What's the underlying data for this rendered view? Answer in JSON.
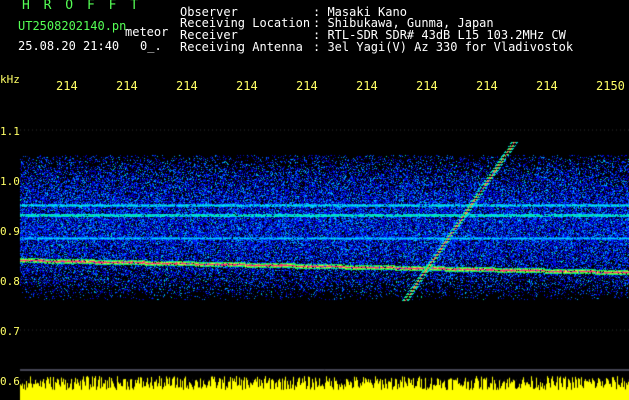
{
  "header": {
    "app_title": "H R O F F T",
    "file_name": "UT2508202140.pn",
    "meteor_label": "meteor",
    "timestamp": "25.08.20 21:40",
    "marker": "0_.",
    "fields": [
      {
        "label": "Observer",
        "value": ": Masaki Kano"
      },
      {
        "label": "Receiving Location",
        "value": ": Shibukawa, Gunma, Japan"
      },
      {
        "label": "Receiver",
        "value": ": RTL-SDR SDR# 43dB L15 103.2MHz CW"
      },
      {
        "label": "Receiving Antenna",
        "value": ": 3el Yagi(V) Az 330 for Vladivostok"
      }
    ]
  },
  "axes": {
    "y_unit": "kHz",
    "y_ticks": [
      "1.1",
      "1.0",
      "0.9",
      "0.8",
      "0.7",
      "0.6"
    ],
    "x_ticks": [
      "214",
      "214",
      "214",
      "214",
      "214",
      "214",
      "214",
      "214",
      "214",
      "2150"
    ]
  },
  "colors": {
    "title_green": "#55ff55",
    "text_white": "#ffffff",
    "tick_yellow": "#ffff66",
    "background": "#000000"
  }
}
